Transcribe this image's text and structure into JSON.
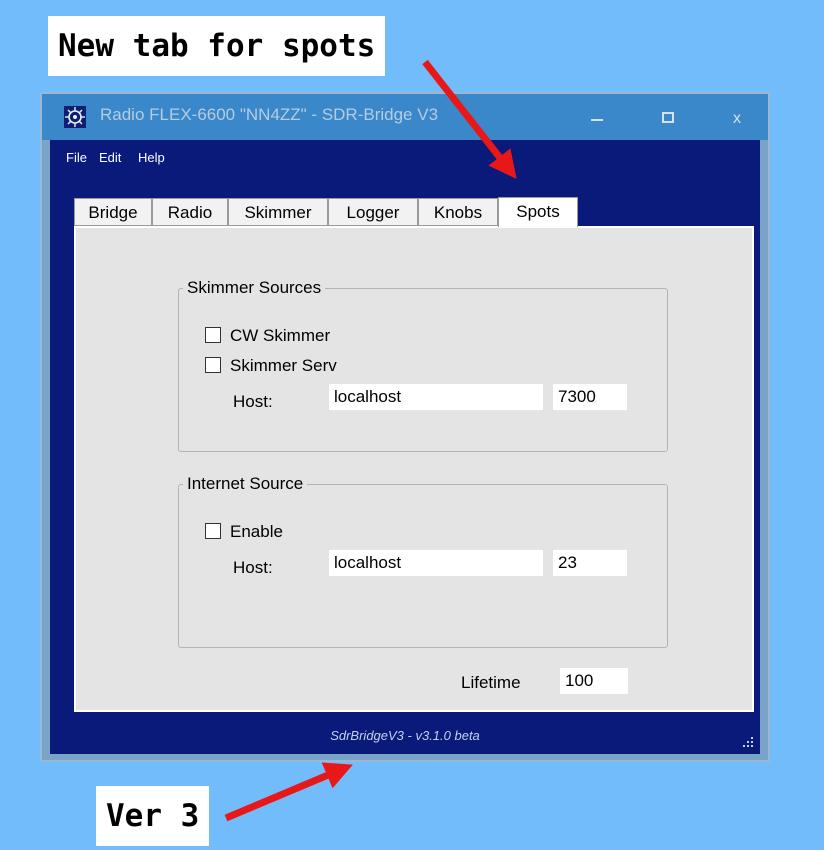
{
  "annotations": {
    "top": "New tab for spots",
    "bottom": "Ver 3"
  },
  "window": {
    "title": "Radio FLEX-6600 \"NN4ZZ\" - SDR-Bridge V3",
    "icon": "radio-icon",
    "controls": {
      "minimize": "minimize-icon",
      "maximize": "maximize-icon",
      "close": "x"
    }
  },
  "menu": [
    "File",
    "Edit",
    "Help"
  ],
  "tabs": [
    "Bridge",
    "Radio",
    "Skimmer",
    "Logger",
    "Knobs",
    "Spots"
  ],
  "active_tab": "Spots",
  "skimmer_sources": {
    "legend": "Skimmer Sources",
    "cw_skimmer": {
      "label": "CW Skimmer",
      "checked": false
    },
    "skimmer_serv": {
      "label": "Skimmer Serv",
      "checked": false
    },
    "host_label": "Host:",
    "host": "localhost",
    "port": "7300"
  },
  "internet_source": {
    "legend": "Internet Source",
    "enable": {
      "label": "Enable",
      "checked": false
    },
    "host_label": "Host:",
    "host": "localhost",
    "port": "23"
  },
  "lifetime": {
    "label": "Lifetime",
    "value": "100"
  },
  "status": "SdrBridgeV3 - v3.1.0 beta",
  "colors": {
    "background": "#72bcfb",
    "titlebar": "#3a87c9",
    "client": "#0a1a7a",
    "panel": "#e4e4e4",
    "arrow": "#e81818"
  }
}
